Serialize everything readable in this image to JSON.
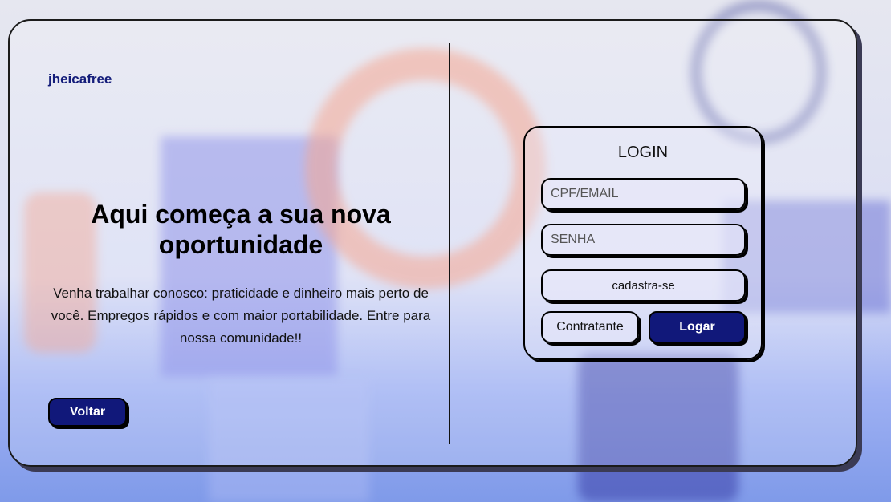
{
  "brand": "jheicafree",
  "hero": {
    "headline": "Aqui começa a sua nova oportunidade",
    "text": "Venha trabalhar conosco: praticidade e dinheiro mais perto de você. Empregos rápidos e com maior portabilidade. Entre para nossa comunidade!!"
  },
  "back_label": "Voltar",
  "login": {
    "title": "LOGIN",
    "user_placeholder": "CPF/EMAIL",
    "password_placeholder": "SENHA",
    "register_label": "cadastra-se",
    "contractor_label": "Contratante",
    "submit_label": "Logar"
  },
  "colors": {
    "accent": "#11187a",
    "brand_text": "#141d7a"
  }
}
